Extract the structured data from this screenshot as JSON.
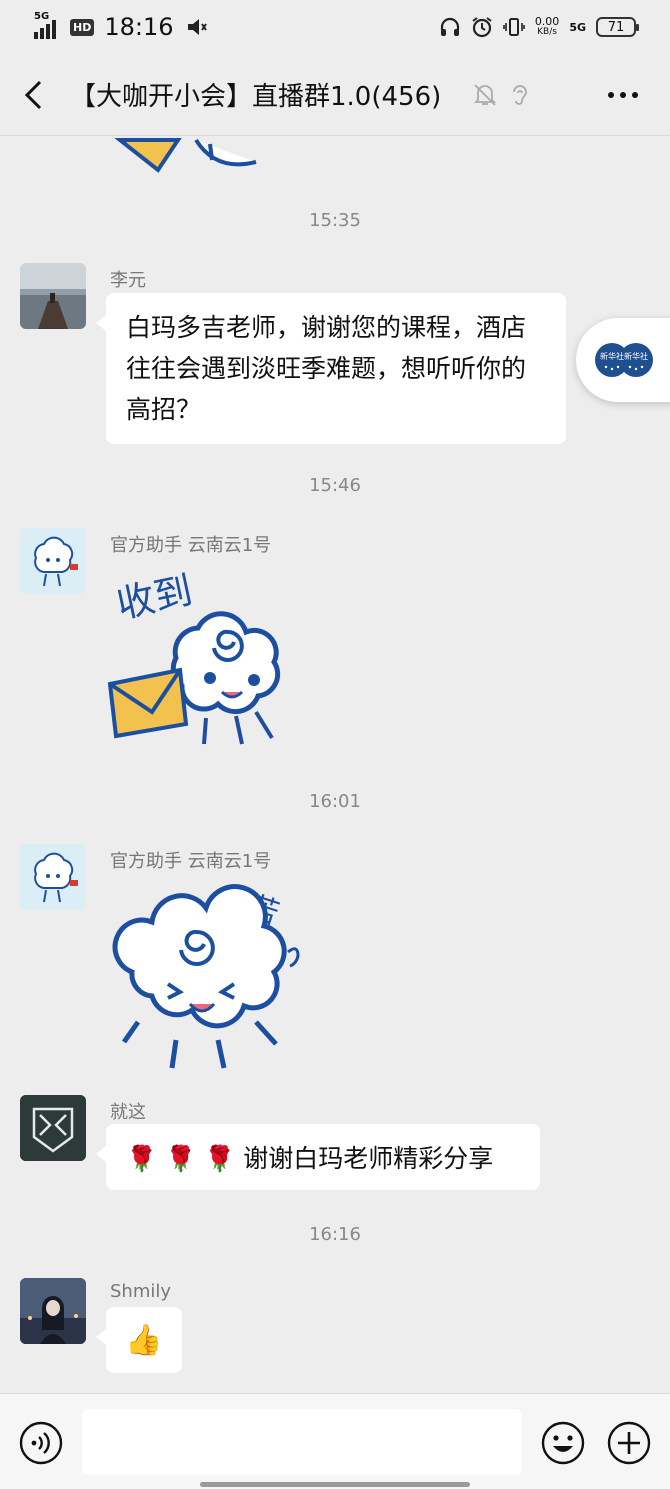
{
  "status_bar": {
    "network_1": "5G",
    "hd": "HD",
    "time": "18:16",
    "speed_value": "0.00",
    "speed_unit": "KB/s",
    "network_2": "5G",
    "battery": "71"
  },
  "header": {
    "title": "【大咖开小会】直播群1.0(456)"
  },
  "messages": [
    {
      "type": "timestamp",
      "text": "15:35"
    },
    {
      "type": "text",
      "sender": "李元",
      "text": "白玛多吉老师，谢谢您的课程，酒店往往会遇到淡旺季难题，想听听你的高招？"
    },
    {
      "type": "timestamp",
      "text": "15:46"
    },
    {
      "type": "sticker",
      "sender": "官方助手 云南云1号",
      "sticker_text": "收到"
    },
    {
      "type": "timestamp",
      "text": "16:01"
    },
    {
      "type": "sticker",
      "sender": "官方助手 云南云1号",
      "sticker_text": "辛苦"
    },
    {
      "type": "text",
      "sender": "就这",
      "text": "🌹 🌹 🌹 谢谢白玛老师精彩分享"
    },
    {
      "type": "timestamp",
      "text": "16:16"
    },
    {
      "type": "emoji",
      "sender": "Shmily",
      "text": "👍"
    }
  ],
  "floating_card": {
    "label_1": "新华社",
    "label_2": "新华社"
  },
  "input_bar": {
    "placeholder": ""
  },
  "colors": {
    "background": "#ededed",
    "bubble": "#ffffff",
    "timestamp": "#888888",
    "sender": "#777777",
    "sticker_blue": "#1d4fa0",
    "envelope": "#f2c14e"
  }
}
